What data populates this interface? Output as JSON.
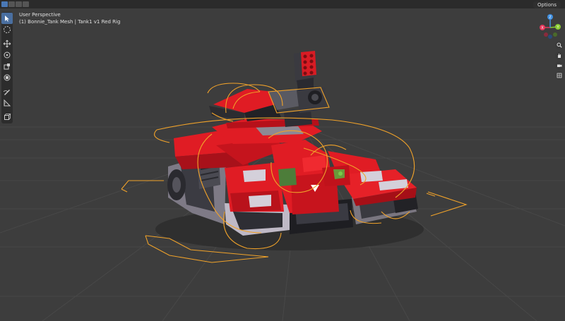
{
  "header": {
    "options_label": "Options",
    "mode_buttons": [
      "select-box",
      "select-extend",
      "select-subtract",
      "select-invert"
    ]
  },
  "viewport": {
    "perspective_label": "User Perspective",
    "object_label": "(1) Bonnie_Tank Mesh | Tank1 v1 Red Rig"
  },
  "toolbar": {
    "tools": [
      "select-box",
      "cursor",
      "move",
      "rotate",
      "scale",
      "transform",
      "annotate",
      "measure",
      "add-cube"
    ]
  },
  "gizmo": {
    "axes": [
      "X",
      "Y",
      "Z"
    ],
    "colors": {
      "x": "#e5395b",
      "y": "#8acb32",
      "z": "#3f8fe0"
    }
  },
  "nav_buttons": [
    "zoom",
    "pan",
    "camera",
    "perspective-toggle"
  ],
  "colors": {
    "background": "#3d3d3d",
    "tank_red": "#e01c24",
    "rig_orange": "#f0a22a",
    "accent_blue": "#4a78b5"
  }
}
